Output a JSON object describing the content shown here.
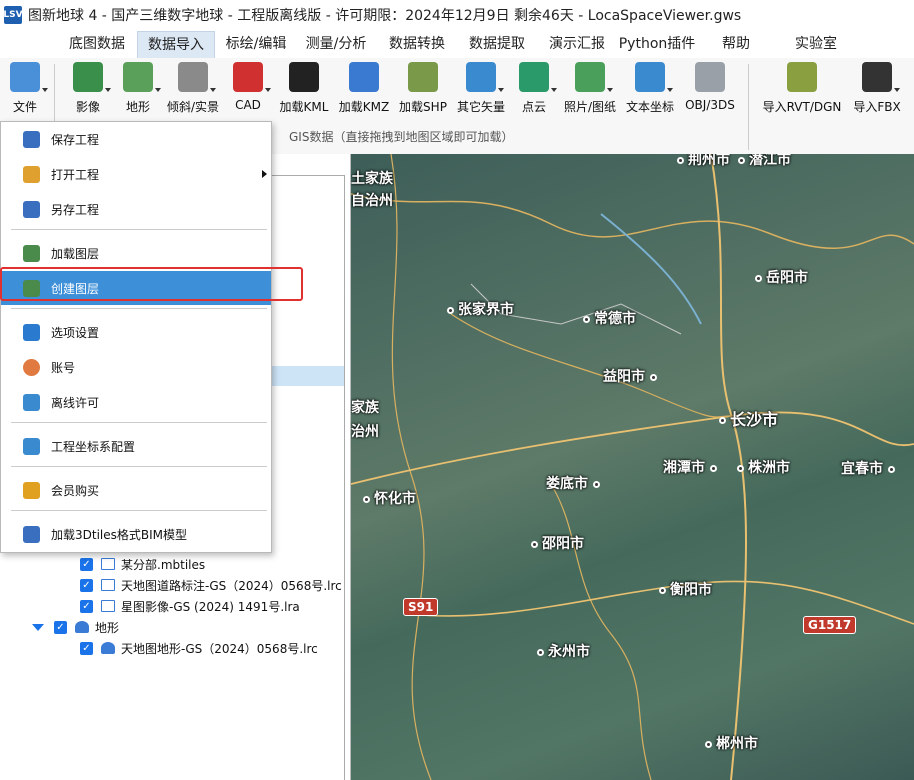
{
  "window": {
    "title": "图新地球 4 - 国产三维数字地球 - 工程版离线版 - 许可期限：2024年12月9日 剩余46天 - LocaSpaceViewer.gws",
    "app_icon_text": "LSV"
  },
  "menu": {
    "items": [
      "底图数据",
      "数据导入",
      "标绘/编辑",
      "测量/分析",
      "数据转换",
      "数据提取",
      "演示汇报",
      "Python插件",
      "帮助",
      "实验室"
    ],
    "active": "数据导入"
  },
  "ribbon": {
    "tools": [
      {
        "label": "文件",
        "icon": "file-icon",
        "color": "#4a90d9"
      },
      {
        "label": "影像",
        "icon": "image-layer-icon",
        "color": "#3a8f4a"
      },
      {
        "label": "地形",
        "icon": "terrain-icon",
        "color": "#5aa05a"
      },
      {
        "label": "倾斜/实景",
        "icon": "oblique-model-icon",
        "color": "#8a8a8a"
      },
      {
        "label": "CAD",
        "icon": "cad-icon",
        "color": "#d03030"
      },
      {
        "label": "加载KML",
        "icon": "kml-icon",
        "color": "#222222"
      },
      {
        "label": "加载KMZ",
        "icon": "kmz-icon",
        "color": "#3a7ad0"
      },
      {
        "label": "加载SHP",
        "icon": "shp-icon",
        "color": "#7a9a4a"
      },
      {
        "label": "其它矢量",
        "icon": "vector-icon",
        "color": "#3a8ad0"
      },
      {
        "label": "点云",
        "icon": "point-cloud-icon",
        "color": "#2a9a6a"
      },
      {
        "label": "照片/图纸",
        "icon": "photo-icon",
        "color": "#4aa05a"
      },
      {
        "label": "文本坐标",
        "icon": "text-coordinate-icon",
        "color": "#3a8ad0"
      },
      {
        "label": "OBJ/3DS",
        "icon": "obj-model-icon",
        "color": "#9aa0a8"
      },
      {
        "label": "导入RVT/DGN",
        "icon": "rvt-icon",
        "color": "#8aa040"
      },
      {
        "label": "导入FBX",
        "icon": "fbx-icon",
        "color": "#333333"
      }
    ],
    "group_label": "GIS数据（直接拖拽到地图区域即可加载）"
  },
  "file_menu": {
    "items": [
      {
        "label": "保存工程",
        "icon": "save-icon",
        "color": "#3a6fc0"
      },
      {
        "label": "打开工程",
        "icon": "open-project-icon",
        "color": "#e0a030",
        "has_submenu": true
      },
      {
        "label": "另存工程",
        "icon": "save-as-icon",
        "color": "#3a6fc0"
      },
      {
        "label": "加载图层",
        "icon": "load-layer-icon",
        "color": "#4a8a4a"
      },
      {
        "label": "创建图层",
        "icon": "create-layer-icon",
        "color": "#4a8a4a",
        "highlighted": true
      },
      {
        "label": "选项设置",
        "icon": "settings-icon",
        "color": "#2a7ad0"
      },
      {
        "label": "账号",
        "icon": "account-icon",
        "color": "#e07a40"
      },
      {
        "label": "离线许可",
        "icon": "license-icon",
        "color": "#3a8ad0"
      },
      {
        "label": "工程坐标系配置",
        "icon": "coordinate-config-icon",
        "color": "#3a8ad0"
      },
      {
        "label": "会员购买",
        "icon": "member-purchase-icon",
        "color": "#e0a020"
      },
      {
        "label": "加载3Dtiles格式BIM模型",
        "icon": "bim-model-icon",
        "color": "#3a6fc0"
      }
    ]
  },
  "layer_tree": {
    "rows": [
      {
        "label": "某分部.mbtiles",
        "checked": "✓"
      },
      {
        "label": "天地图道路标注-GS（2024）0568号.lrc",
        "checked": "✓"
      },
      {
        "label": "星图影像-GS (2024) 1491号.lra",
        "checked": "✓"
      },
      {
        "label": "地形",
        "checked": "✓",
        "group": true
      },
      {
        "label": "天地图地形-GS（2024）0568号.lrc",
        "checked": "✓"
      }
    ]
  },
  "map": {
    "labels": [
      "荆州市",
      "潜江市",
      "土家族",
      "自治州",
      "岳阳市",
      "张家界市",
      "常德市",
      "益阳市",
      "长沙市",
      "家族",
      "治州",
      "湘潭市",
      "株洲市",
      "宜春市",
      "怀化市",
      "娄底市",
      "邵阳市",
      "衡阳市",
      "永州市",
      "郴州市"
    ],
    "road_shields": [
      "S91",
      "G1517"
    ],
    "road_shield_colors": [
      "#c0392b",
      "#c0392b"
    ]
  }
}
